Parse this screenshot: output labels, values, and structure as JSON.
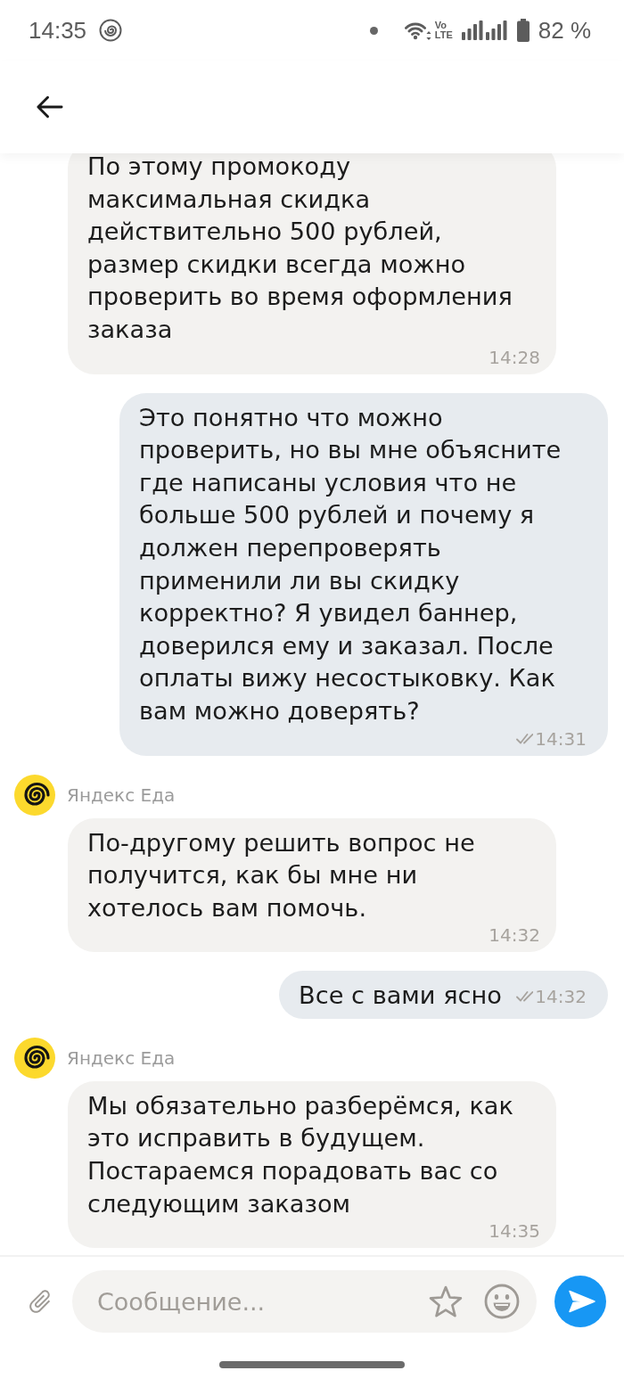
{
  "status_bar": {
    "time": "14:35",
    "network": "Vo LTE",
    "battery": "82 %"
  },
  "messages": [
    {
      "kind": "incoming",
      "text": "По этому промокоду максимальная скидка действительно 500 рублей, размер скидки всегда можно проверить во время оформления заказа",
      "time": "14:28"
    },
    {
      "kind": "outgoing",
      "text": "Это понятно что можно проверить, но вы мне объясните где написаны условия что не больше 500 рублей и почему я должен перепроверять применили ли вы скидку корректно? Я увидел баннер, доверился ему и заказал. После оплаты вижу несостыковку. Как вам можно доверять?",
      "time": "14:31",
      "read": true
    },
    {
      "kind": "incoming",
      "sender": "Яндекс Еда",
      "text": "По-другому решить вопрос не получится, как бы мне ни хотелось вам помочь.",
      "time": "14:32"
    },
    {
      "kind": "outgoing",
      "text": "Все с вами ясно",
      "time": "14:32",
      "read": true
    },
    {
      "kind": "incoming",
      "sender": "Яндекс Еда",
      "text": "Мы обязательно разберёмся, как это исправить в будущем. Постараемся порадовать вас со следующим заказом",
      "time": "14:35"
    }
  ],
  "composer": {
    "placeholder": "Сообщение..."
  }
}
